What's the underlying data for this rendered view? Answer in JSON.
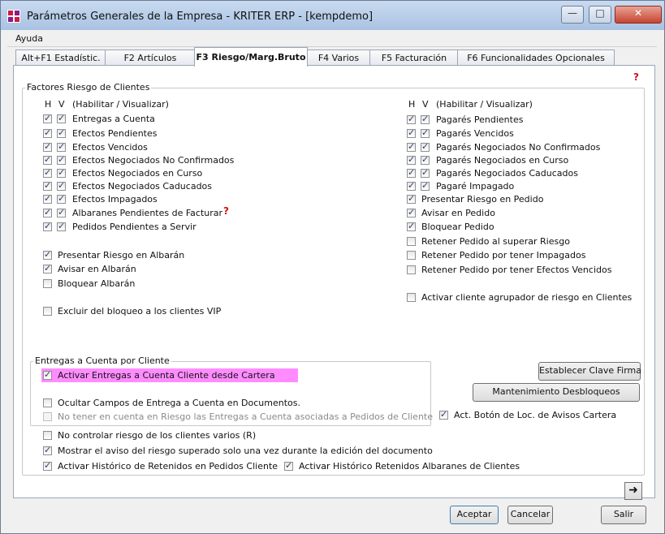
{
  "window": {
    "title": "Parámetros Generales de la Empresa - KRITER ERP - [kempdemo]"
  },
  "menu": {
    "ayuda": "Ayuda"
  },
  "tabs": [
    {
      "label": "Alt+F1 Estadístic."
    },
    {
      "label": "F2 Artículos"
    },
    {
      "label": "F3 Riesgo/Marg.Bruto",
      "active": true
    },
    {
      "label": "F4 Varios"
    },
    {
      "label": "F5 Facturación"
    },
    {
      "label": "F6 Funcionalidades Opcionales"
    }
  ],
  "factores": {
    "title": "Factores Riesgo de Clientes",
    "header_h": "H",
    "header_v": "V",
    "header_text": "(Habilitar / Visualizar)",
    "left_items": [
      {
        "label": "Entregas a Cuenta",
        "h": true,
        "v": true
      },
      {
        "label": "Efectos Pendientes",
        "h": true,
        "v": true
      },
      {
        "label": "Efectos Vencidos",
        "h": true,
        "v": true
      },
      {
        "label": "Efectos Negociados No Confirmados",
        "h": true,
        "v": true
      },
      {
        "label": "Efectos Negociados en Curso",
        "h": true,
        "v": true
      },
      {
        "label": "Efectos Negociados Caducados",
        "h": true,
        "v": true
      },
      {
        "label": "Efectos Impagados",
        "h": true,
        "v": true
      },
      {
        "label": "Albaranes Pendientes de Facturar",
        "h": true,
        "v": true
      },
      {
        "label": "Pedidos Pendientes a Servir",
        "h": true,
        "v": true
      }
    ],
    "right_items": [
      {
        "label": "Pagarés Pendientes",
        "h": true,
        "v": true
      },
      {
        "label": "Pagarés Vencidos",
        "h": true,
        "v": true
      },
      {
        "label": "Pagarés Negociados No Confirmados",
        "h": true,
        "v": true
      },
      {
        "label": "Pagarés Negociados en Curso",
        "h": true,
        "v": true
      },
      {
        "label": "Pagarés Negociados Caducados",
        "h": true,
        "v": true
      },
      {
        "label": "Pagaré Impagado",
        "h": true,
        "v": true
      }
    ],
    "left_options": [
      {
        "label": "Presentar Riesgo en Albarán",
        "checked": true
      },
      {
        "label": "Avisar en Albarán",
        "checked": true
      },
      {
        "label": "Bloquear Albarán",
        "checked": false
      },
      {
        "label": "Excluir del bloqueo a los clientes VIP",
        "checked": false
      }
    ],
    "right_options": [
      {
        "label": "Presentar Riesgo en Pedido",
        "checked": true
      },
      {
        "label": "Avisar en Pedido",
        "checked": true
      },
      {
        "label": "Bloquear Pedido",
        "checked": true
      },
      {
        "label": "Retener Pedido al superar Riesgo",
        "checked": false
      },
      {
        "label": "Retener Pedido por tener Impagados",
        "checked": false
      },
      {
        "label": "Retener Pedido por tener Efectos Vencidos",
        "checked": false
      },
      {
        "label": "Activar cliente agrupador de riesgo en Clientes",
        "checked": false
      }
    ]
  },
  "entregas": {
    "title": "Entregas a Cuenta por Cliente",
    "items": [
      {
        "label": "Activar Entregas a Cuenta Cliente desde Cartera",
        "checked": true
      },
      {
        "label": "Ocultar Campos de Entrega a Cuenta en Documentos.",
        "checked": false
      },
      {
        "label": "No tener en cuenta en Riesgo las Entregas a Cuenta asociadas a Pedidos de Cliente",
        "checked": false,
        "disabled": true
      }
    ]
  },
  "buttons": {
    "clave_firma": "Establecer Clave Firma",
    "desbloqueos": "Mantenimiento Desbloqueos",
    "aceptar": "Aceptar",
    "cancelar": "Cancelar",
    "salir": "Salir"
  },
  "act_boton_avisos": {
    "label": "Act. Botón de Loc. de Avisos Cartera",
    "checked": true
  },
  "bottom_options": [
    {
      "label": "No controlar riesgo de los clientes varios (R)",
      "checked": false
    },
    {
      "label": "Mostrar el aviso del riesgo superado solo una vez durante la edición del documento",
      "checked": true
    },
    {
      "label": "Activar Histórico de Retenidos en Pedidos Cliente",
      "checked": true
    },
    {
      "label": "Activar Histórico Retenidos Albaranes de Clientes",
      "checked": true
    }
  ],
  "icons": {
    "help": "question-mark-icon",
    "arrow": "arrow-right-icon",
    "app": "kriter-app-icon"
  },
  "colors": {
    "highlight": "#ff8cff",
    "help": "#d0101a"
  }
}
